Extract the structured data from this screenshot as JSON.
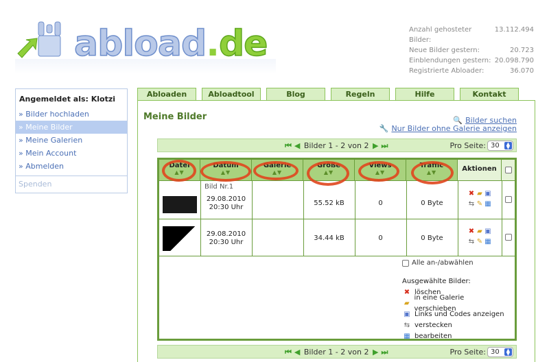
{
  "logo": {
    "abload": "abload",
    "dot": ".",
    "de": "de"
  },
  "stats": [
    {
      "label": "Anzahl gehosteter Bilder:",
      "value": "13.112.494"
    },
    {
      "label": "Neue Bilder gestern:",
      "value": "20.723"
    },
    {
      "label": "Einblendungen gestern:",
      "value": "20.098.790"
    },
    {
      "label": "Registrierte Abloader:",
      "value": "36.070"
    }
  ],
  "sidebar": {
    "title": "Angemeldet als: Klotzi",
    "items": [
      {
        "label": "» Bilder hochladen"
      },
      {
        "label": "» Meine Bilder"
      },
      {
        "label": "» Meine Galerien"
      },
      {
        "label": "» Mein Account"
      },
      {
        "label": "» Abmelden"
      }
    ],
    "spenden": "Spenden"
  },
  "tabs": [
    "Abloaden",
    "Abloadtool",
    "Blog",
    "Regeln",
    "Hilfe",
    "Kontakt"
  ],
  "main": {
    "title": "Meine Bilder",
    "link_search": "Bilder suchen",
    "link_nogallery": "Nur Bilder ohne Galerie anzeigen"
  },
  "pager": {
    "first": "⏮",
    "prev": "◀",
    "text": "Bilder 1 - 2 von 2",
    "next": "▶",
    "last": "⏭",
    "per_page_label": "Pro Seite:",
    "per_page_value": "30"
  },
  "table": {
    "headers": {
      "datei": "Datei",
      "datum": "Datum",
      "galerie": "Galerie",
      "groesse": "Größe",
      "views": "Views",
      "traffic": "Traffic",
      "aktionen": "Aktionen"
    },
    "sort_icon": "▲▼",
    "rows": [
      {
        "name": "Bild Nr.1",
        "date": "29.08.2010",
        "time": "20:30 Uhr",
        "galerie": "",
        "size": "55.52 kB",
        "views": "0",
        "traffic": "0 Byte"
      },
      {
        "name": "",
        "date": "29.08.2010",
        "time": "20:30 Uhr",
        "galerie": "",
        "size": "34.44 kB",
        "views": "0",
        "traffic": "0 Byte"
      }
    ]
  },
  "legend": {
    "select_all": "Alle an-/abwählen",
    "heading": "Ausgewählte Bilder:",
    "items": [
      {
        "icon": "delete-icon",
        "label": "löschen"
      },
      {
        "icon": "folder-move-icon",
        "label": "in eine Galerie verschieben"
      },
      {
        "icon": "links-icon",
        "label": "Links und Codes anzeigen"
      },
      {
        "icon": "hide-icon",
        "label": "verstecken"
      },
      {
        "icon": "edit-icon",
        "label": "bearbeiten"
      }
    ]
  },
  "colors": {
    "accent_green": "#8cc35a",
    "header_green": "#a9d27e",
    "link_blue": "#4a6fb5",
    "annotation_red": "#e0461e"
  }
}
